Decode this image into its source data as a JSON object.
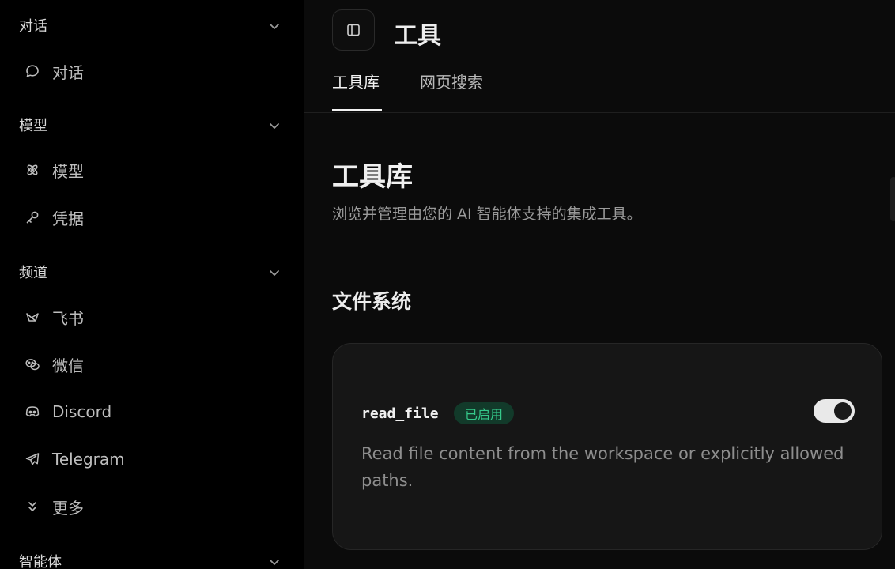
{
  "sidebar": {
    "sections": {
      "chat": {
        "label": "对话"
      },
      "models": {
        "label": "模型"
      },
      "channels": {
        "label": "频道"
      },
      "agents": {
        "label": "智能体"
      }
    },
    "items": {
      "chat": "对话",
      "models": "模型",
      "credentials": "凭据",
      "feishu": "飞书",
      "wechat": "微信",
      "discord": "Discord",
      "telegram": "Telegram",
      "more": "更多"
    }
  },
  "header": {
    "title": "工具"
  },
  "tabs": [
    {
      "label": "工具库",
      "active": true
    },
    {
      "label": "网页搜索",
      "active": false
    }
  ],
  "main": {
    "section_title": "工具库",
    "section_description": "浏览并管理由您的 AI 智能体支持的集成工具。",
    "group_title": "文件系统",
    "tool": {
      "name": "read_file",
      "status": "已启用",
      "enabled": true,
      "description": "Read file content from the workspace or explicitly allowed paths."
    }
  },
  "colors": {
    "background": "#000000",
    "card": "#161616",
    "badge_bg": "#123a2a",
    "badge_text": "#35c98a",
    "switch_on": "#e9e9e9"
  }
}
